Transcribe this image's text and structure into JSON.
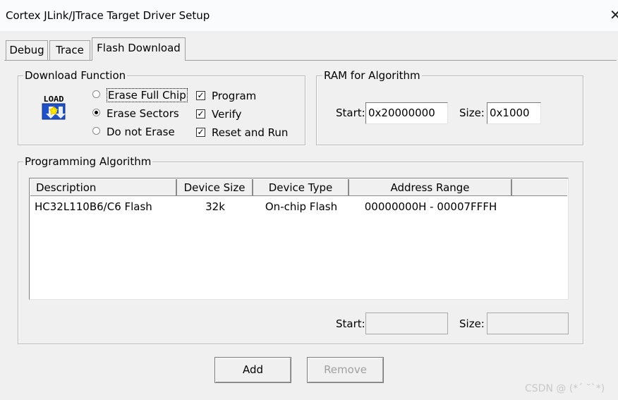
{
  "window": {
    "title": "Cortex JLink/JTrace Target Driver Setup",
    "close_glyph": "✕"
  },
  "tabs": [
    {
      "label": "Debug"
    },
    {
      "label": "Trace"
    },
    {
      "label": "Flash Download",
      "active": true
    }
  ],
  "download_function": {
    "legend": "Download Function",
    "icon": "load-icon",
    "icon_text": "LOAD",
    "options": [
      {
        "label": "Erase Full Chip",
        "selected": false
      },
      {
        "label": "Erase Sectors",
        "selected": true
      },
      {
        "label": "Do not Erase",
        "selected": false
      }
    ],
    "checks": [
      {
        "label": "Program",
        "checked": true
      },
      {
        "label": "Verify",
        "checked": true
      },
      {
        "label": "Reset and Run",
        "checked": true
      }
    ]
  },
  "ram": {
    "legend": "RAM for Algorithm",
    "start_label": "Start:",
    "start_value": "0x20000000",
    "size_label": "Size:",
    "size_value": "0x1000"
  },
  "programming": {
    "legend": "Programming Algorithm",
    "columns": [
      "Description",
      "Device Size",
      "Device Type",
      "Address Range"
    ],
    "rows": [
      {
        "description": "HC32L110B6/C6 Flash",
        "size": "32k",
        "type": "On-chip Flash",
        "range": "00000000H - 00007FFFH"
      }
    ],
    "start_label": "Start:",
    "start_value": "",
    "size_label": "Size:",
    "size_value": ""
  },
  "buttons": {
    "add": "Add",
    "remove": "Remove"
  },
  "watermark": "CSDN @ (*´ ˘`*)"
}
